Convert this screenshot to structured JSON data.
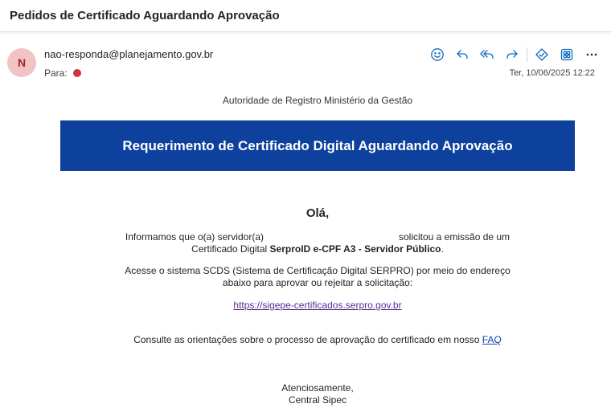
{
  "header": {
    "subject": "Pedidos de Certificado Aguardando Aprovação"
  },
  "message": {
    "avatar_initial": "N",
    "sender": "nao-responda@planejamento.gov.br",
    "to_label": "Para:",
    "timestamp": "Ter, 10/06/2025 12:22",
    "actions": [
      "emoji-icon",
      "reply-icon",
      "reply-all-icon",
      "forward-icon",
      "tag-icon",
      "apps-icon",
      "more-icon"
    ]
  },
  "body": {
    "org": "Autoridade de Registro Ministério da Gestão",
    "banner_title": "Requerimento de Certificado Digital Aguardando Aprovação",
    "greeting": "Olá,",
    "p1_a": "Informamos que o(a) servidor(a)",
    "p1_b": "solicitou a emissão de um",
    "p1_c": "Certificado Digital ",
    "p1_bold": "SerproID e-CPF A3 - Servidor Público",
    "p1_end": ".",
    "p2_line1": "Acesse o sistema SCDS (Sistema de Certificação Digital SERPRO) por meio do endereço",
    "p2_line2": "abaixo para aprovar ou rejeitar a solicitação:",
    "link": "https://sigepe-certificados.serpro.gov.br",
    "p3_text": "Consulte as orientações sobre o processo de aprovação do certificado em nosso ",
    "p3_link": "FAQ",
    "closing_line1": "Atenciosamente,",
    "closing_line2": "Central Sipec"
  },
  "colors": {
    "banner": "#0d419d",
    "icon_blue": "#0f6cbd",
    "avatar_bg": "#f2c3c3",
    "avatar_fg": "#a4262c",
    "status_dot": "#d13438",
    "link_visited": "#5b2b92",
    "link": "#0645ad"
  }
}
